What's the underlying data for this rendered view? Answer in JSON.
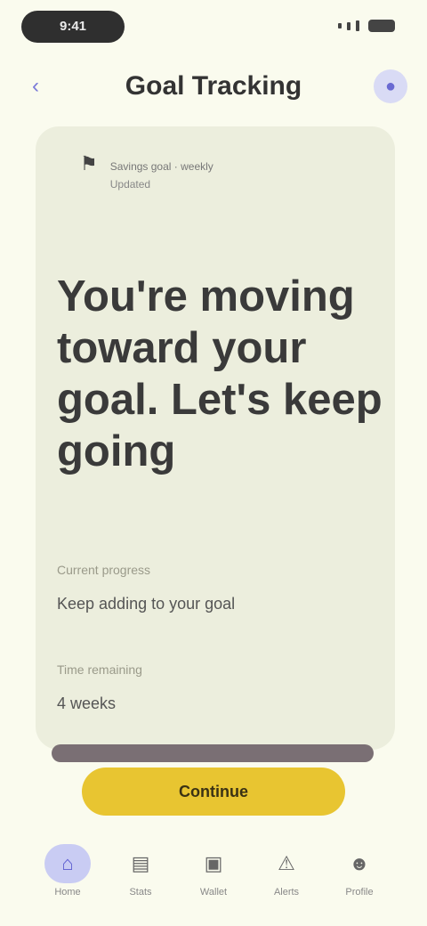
{
  "status_bar": {
    "time": "9:41"
  },
  "header": {
    "back_icon": "chevron-left-icon",
    "title": "Goal Tracking",
    "profile_icon": "person-icon"
  },
  "card": {
    "meta_icon": "flag-icon",
    "meta_line_1": "Savings goal · weekly",
    "meta_line_2": "Updated",
    "headline": "You're moving toward your goal. Let's keep going",
    "stat_1_label": "Current progress",
    "stat_1_value": "Keep adding to your goal",
    "stat_2_label": "Time remaining",
    "stat_2_value": "4 weeks"
  },
  "cta": {
    "label": "Continue"
  },
  "bottom_nav": {
    "items": [
      {
        "icon": "home-icon",
        "label": "Home",
        "active": true
      },
      {
        "icon": "chart-icon",
        "label": "Stats",
        "active": false
      },
      {
        "icon": "wallet-icon",
        "label": "Wallet",
        "active": false
      },
      {
        "icon": "bell-icon",
        "label": "Alerts",
        "active": false
      },
      {
        "icon": "person-icon",
        "label": "Profile",
        "active": false
      }
    ]
  },
  "colors": {
    "background": "#fafbee",
    "card": "#eceedd",
    "accent": "#e8c531",
    "active_nav": "#c9ccf3"
  }
}
